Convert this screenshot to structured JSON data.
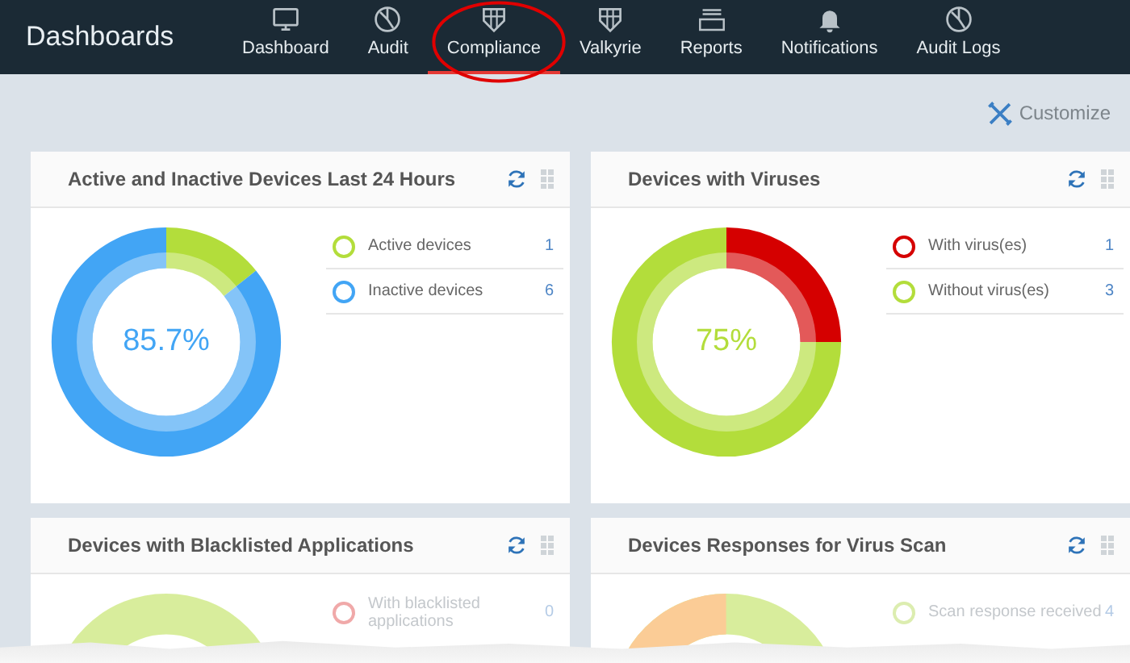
{
  "header": {
    "title": "Dashboards",
    "tabs": [
      {
        "label": "Dashboard",
        "selected": false
      },
      {
        "label": "Audit",
        "selected": false
      },
      {
        "label": "Compliance",
        "selected": true
      },
      {
        "label": "Valkyrie",
        "selected": false
      },
      {
        "label": "Reports",
        "selected": false
      },
      {
        "label": "Notifications",
        "selected": false
      },
      {
        "label": "Audit Logs",
        "selected": false
      }
    ]
  },
  "customize": {
    "label": "Customize"
  },
  "widgets": [
    {
      "title": "Active and Inactive Devices Last 24 Hours",
      "center_label": "85.7%",
      "legend": [
        {
          "count": "1",
          "color": "#b3dd3b"
        },
        {
          "count": "6",
          "color": "#42a5f5"
        }
      ],
      "chart_data": {
        "type": "donut",
        "categories": [
          "Active devices",
          "Inactive devices"
        ],
        "values": [
          14.3,
          85.7
        ]
      }
    },
    {
      "title": "Devices with Viruses",
      "center_label": "75%",
      "legend": [
        {
          "count": "1",
          "color": "#d50000"
        },
        {
          "count": "3",
          "color": "#b3dd3b"
        }
      ],
      "chart_data": {
        "type": "donut",
        "categories": [
          "With virus(es)",
          "Without virus(es)"
        ],
        "values": [
          25,
          75
        ]
      }
    },
    {
      "title": "Devices with Blacklisted Applications",
      "legend": [
        {
          "label": "With blacklisted applications",
          "count": "0",
          "color": "#f0a9a9"
        }
      ]
    },
    {
      "title": "Devices Responses for Virus Scan",
      "legend": [
        {
          "label": "Scan response received",
          "count": "4",
          "color": "#dcedb0"
        }
      ]
    }
  ]
}
